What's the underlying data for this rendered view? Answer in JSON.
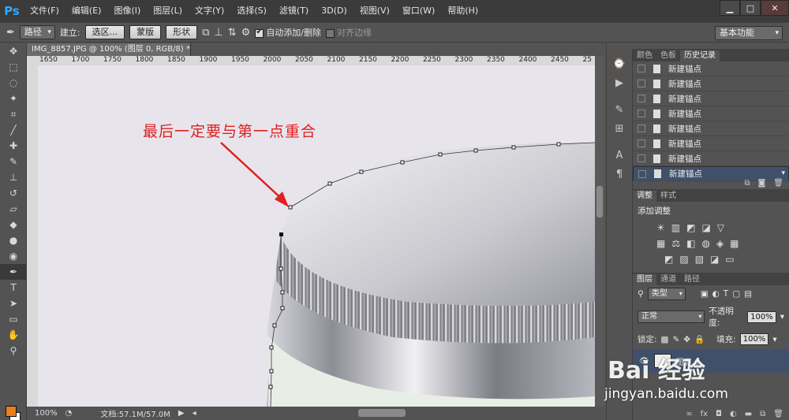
{
  "app": {
    "logo": "Ps"
  },
  "menu": [
    "文件(F)",
    "编辑(E)",
    "图像(I)",
    "图层(L)",
    "文字(Y)",
    "选择(S)",
    "滤镜(T)",
    "3D(D)",
    "视图(V)",
    "窗口(W)",
    "帮助(H)"
  ],
  "options": {
    "mode": "路径",
    "build_label": "建立:",
    "btn_selection": "选区...",
    "btn_mask": "蒙版",
    "btn_shape": "形状",
    "auto_add_label": "自动添加/删除",
    "align_edges_label": "对齐边缘",
    "workspace": "基本功能"
  },
  "document": {
    "tab_title": "IMG_8857.JPG @ 100% (图层 0, RGB/8) *",
    "ruler_ticks": [
      "1650",
      "1700",
      "1750",
      "1800",
      "1850",
      "1900",
      "1950",
      "2000",
      "2050",
      "2100",
      "2150",
      "2200",
      "2250",
      "2300",
      "2350",
      "2400",
      "2450",
      "25"
    ],
    "annotation": "最后一定要与第一点重合",
    "zoom": "100%",
    "doc_info": "文档:57.1M/57.0M"
  },
  "panels": {
    "top_tabs": [
      "颜色",
      "色板",
      "历史记录"
    ],
    "history": [
      "新建锚点",
      "新建锚点",
      "新建锚点",
      "新建锚点",
      "新建锚点",
      "新建锚点",
      "新建锚点",
      "新建锚点"
    ],
    "adjust_tabs": [
      "调整",
      "样式"
    ],
    "adjust_title": "添加调整",
    "layer_tabs": [
      "图层",
      "通道",
      "路径"
    ],
    "kind": "类型",
    "blend": "正常",
    "opacity_label": "不透明度:",
    "opacity": "100%",
    "lock_label": "锁定:",
    "fill_label": "填充:",
    "fill": "100%",
    "layer_name": "图层 0"
  },
  "watermark": {
    "brand": "Bai 经验",
    "url": "jingyan.baidu.com"
  },
  "colors": {
    "accent": "#31a8ff",
    "annotation": "#e02020",
    "selection": "#41506a",
    "foreground": "#e67e22"
  }
}
